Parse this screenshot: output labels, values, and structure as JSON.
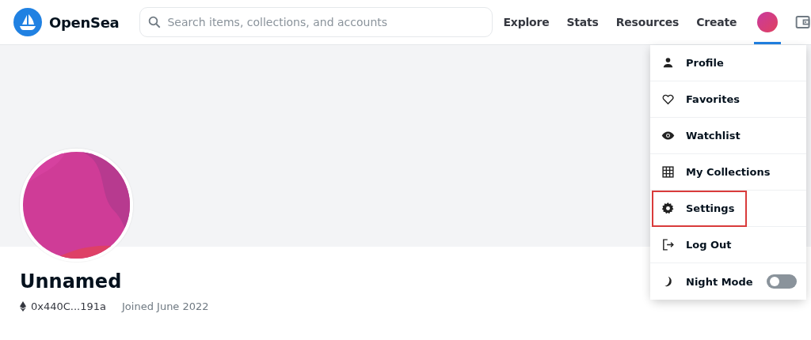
{
  "header": {
    "logo_text": "OpenSea",
    "search": {
      "placeholder": "Search items, collections, and accounts"
    },
    "nav": [
      "Explore",
      "Stats",
      "Resources",
      "Create"
    ],
    "account_button": {
      "selected": true
    }
  },
  "profile": {
    "name": "Unnamed",
    "address": "0x440C...191a",
    "joined": "Joined June 2022"
  },
  "account_menu": {
    "items": [
      {
        "kind": "link",
        "label": "Profile",
        "highlighted": false
      },
      {
        "kind": "link",
        "label": "Favorites",
        "highlighted": false
      },
      {
        "kind": "link",
        "label": "Watchlist",
        "highlighted": false
      },
      {
        "kind": "link",
        "label": "My Collections",
        "highlighted": false
      },
      {
        "kind": "link",
        "label": "Settings",
        "highlighted": true
      },
      {
        "kind": "link",
        "label": "Log Out",
        "highlighted": false
      },
      {
        "kind": "toggle",
        "label": "Night Mode",
        "on": false,
        "highlighted": false
      }
    ]
  }
}
